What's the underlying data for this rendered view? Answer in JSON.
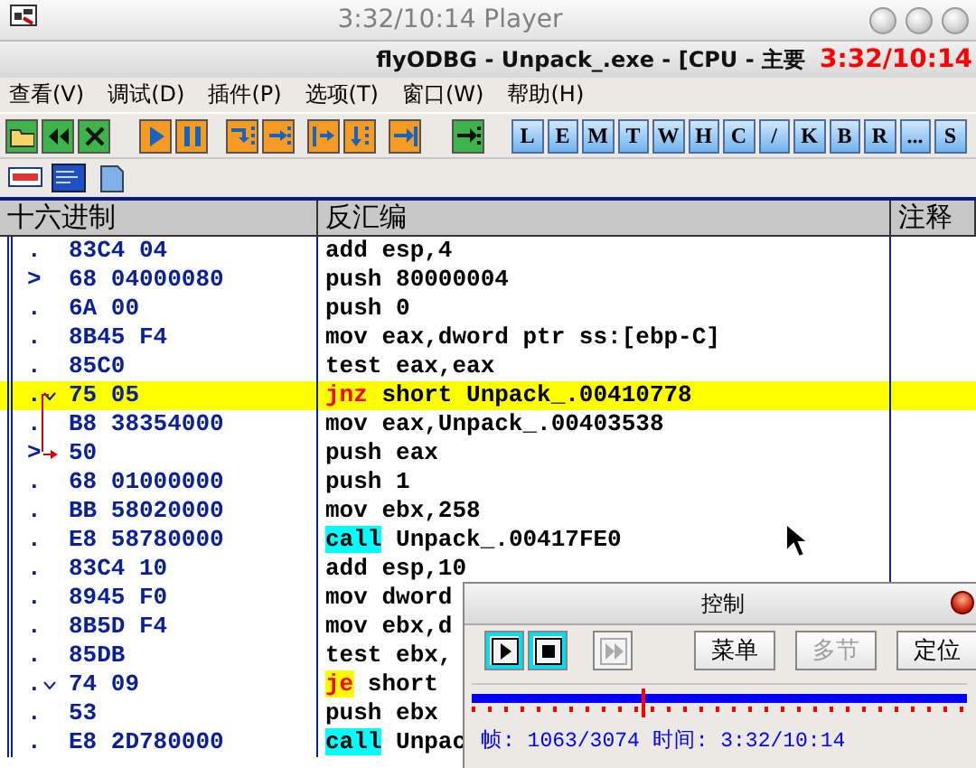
{
  "player": {
    "title": "3:32/10:14 Player",
    "overlay_time": "3:32/10:14"
  },
  "app": {
    "title": "flyODBG - Unpack_.exe - [CPU - 主要"
  },
  "menu": [
    "查看(V)",
    "调试(D)",
    "插件(P)",
    "选项(T)",
    "窗口(W)",
    "帮助(H)"
  ],
  "toolbar": [
    {
      "kind": "icon",
      "color": "#3cb44a"
    },
    {
      "kind": "icon",
      "color": "#3cb44a"
    },
    {
      "kind": "icon",
      "color": "#3cb44a"
    },
    {
      "kind": "gap"
    },
    {
      "kind": "icon",
      "color": "#f59a23"
    },
    {
      "kind": "icon",
      "color": "#f59a23"
    },
    {
      "kind": "gap"
    },
    {
      "kind": "icon",
      "color": "#f59a23"
    },
    {
      "kind": "icon",
      "color": "#f59a23"
    },
    {
      "kind": "gap"
    },
    {
      "kind": "icon",
      "color": "#f59a23"
    },
    {
      "kind": "icon",
      "color": "#f59a23"
    },
    {
      "kind": "gap"
    },
    {
      "kind": "icon",
      "color": "#f59a23"
    },
    {
      "kind": "gap"
    },
    {
      "kind": "icon",
      "color": "#3cb44a"
    },
    {
      "kind": "gap"
    },
    {
      "kind": "letter",
      "label": "L"
    },
    {
      "kind": "letter",
      "label": "E"
    },
    {
      "kind": "letter",
      "label": "M"
    },
    {
      "kind": "letter",
      "label": "T"
    },
    {
      "kind": "letter",
      "label": "W"
    },
    {
      "kind": "letter",
      "label": "H"
    },
    {
      "kind": "letter",
      "label": "C"
    },
    {
      "kind": "letter",
      "label": "/"
    },
    {
      "kind": "letter",
      "label": "K"
    },
    {
      "kind": "letter",
      "label": "B"
    },
    {
      "kind": "letter",
      "label": "R"
    },
    {
      "kind": "letter",
      "label": "..."
    },
    {
      "kind": "letter",
      "label": "S"
    }
  ],
  "toolbar2": [
    {
      "kind": "icon"
    },
    {
      "kind": "icon"
    },
    {
      "kind": "icon"
    }
  ],
  "cpu": {
    "columns": [
      "十六进制",
      "反汇编",
      "注释"
    ],
    "rows": [
      {
        "marker": ".",
        "hex": "83C4 04",
        "mnemonic": "add",
        "operands": "esp,4",
        "kind": "plain",
        "jump_from": false,
        "jump_target": false,
        "selected": false
      },
      {
        "marker": ">",
        "hex": "68 04000080",
        "mnemonic": "push",
        "operands": "80000004",
        "kind": "plain",
        "jump_from": false,
        "jump_target": false,
        "selected": false
      },
      {
        "marker": ".",
        "hex": "6A 00",
        "mnemonic": "push",
        "operands": "0",
        "kind": "plain",
        "jump_from": false,
        "jump_target": false,
        "selected": false
      },
      {
        "marker": ".",
        "hex": "8B45 F4",
        "mnemonic": "mov",
        "operands": "eax,dword ptr ss:[ebp-C]",
        "kind": "plain",
        "jump_from": false,
        "jump_target": false,
        "selected": false
      },
      {
        "marker": ".",
        "hex": "85C0",
        "mnemonic": "test",
        "operands": "eax,eax",
        "kind": "plain",
        "jump_from": false,
        "jump_target": false,
        "selected": false
      },
      {
        "marker": ".",
        "hex": "75 05",
        "mnemonic": "jnz",
        "operands": "short Unpack_.00410778",
        "kind": "jump",
        "jump_from": true,
        "jump_target": false,
        "selected": true
      },
      {
        "marker": ".",
        "hex": "B8 38354000",
        "mnemonic": "mov",
        "operands": "eax,Unpack_.00403538",
        "kind": "plain",
        "jump_from": false,
        "jump_target": false,
        "selected": false
      },
      {
        "marker": ">",
        "hex": "50",
        "mnemonic": "push",
        "operands": "eax",
        "kind": "plain",
        "jump_from": false,
        "jump_target": true,
        "selected": false
      },
      {
        "marker": ".",
        "hex": "68 01000000",
        "mnemonic": "push",
        "operands": "1",
        "kind": "plain",
        "jump_from": false,
        "jump_target": false,
        "selected": false
      },
      {
        "marker": ".",
        "hex": "BB 58020000",
        "mnemonic": "mov",
        "operands": "ebx,258",
        "kind": "plain",
        "jump_from": false,
        "jump_target": false,
        "selected": false
      },
      {
        "marker": ".",
        "hex": "E8 58780000",
        "mnemonic": "call",
        "operands": "Unpack_.00417FE0",
        "kind": "call",
        "jump_from": false,
        "jump_target": false,
        "selected": false
      },
      {
        "marker": ".",
        "hex": "83C4 10",
        "mnemonic": "add",
        "operands": "esp,10",
        "kind": "plain",
        "jump_from": false,
        "jump_target": false,
        "selected": false
      },
      {
        "marker": ".",
        "hex": "8945 F0",
        "mnemonic": "mov",
        "operands": "dword",
        "kind": "plain",
        "jump_from": false,
        "jump_target": false,
        "selected": false
      },
      {
        "marker": ".",
        "hex": "8B5D F4",
        "mnemonic": "mov",
        "operands": "ebx,d",
        "kind": "plain",
        "jump_from": false,
        "jump_target": false,
        "selected": false
      },
      {
        "marker": ".",
        "hex": "85DB",
        "mnemonic": "test",
        "operands": "ebx,",
        "kind": "plain",
        "jump_from": false,
        "jump_target": false,
        "selected": false
      },
      {
        "marker": ".",
        "hex": "74 09",
        "mnemonic": "je",
        "operands": "short",
        "kind": "jump",
        "jump_from": true,
        "jump_target": false,
        "selected": false
      },
      {
        "marker": ".",
        "hex": "53",
        "mnemonic": "push",
        "operands": "ebx",
        "kind": "plain",
        "jump_from": false,
        "jump_target": false,
        "selected": false
      },
      {
        "marker": ".",
        "hex": "E8 2D780000",
        "mnemonic": "call",
        "operands": "Unpac",
        "kind": "call",
        "jump_from": false,
        "jump_target": false,
        "selected": false
      }
    ]
  },
  "control": {
    "title": "控制",
    "transport": [
      {
        "kind": "play",
        "disabled": false
      },
      {
        "kind": "stop",
        "disabled": false
      },
      {
        "kind": "forward",
        "disabled": true
      }
    ],
    "buttons": [
      {
        "label": "菜单",
        "disabled": false
      },
      {
        "label": "多节",
        "disabled": true
      },
      {
        "label": "定位",
        "disabled": false
      }
    ],
    "level": 0.346,
    "status": "帧: 1063/3074 时间: 3:32/10:14"
  }
}
